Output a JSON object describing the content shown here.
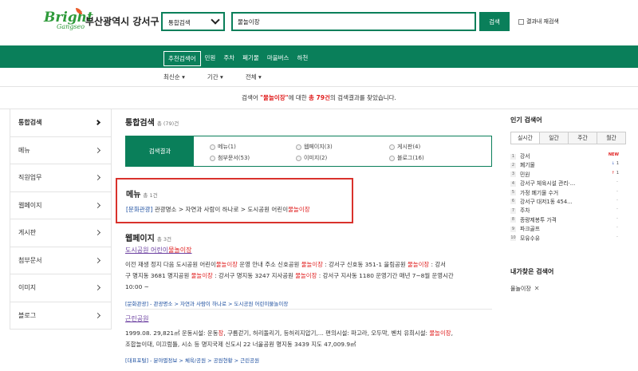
{
  "header": {
    "logo_main": "Bright",
    "logo_sub": "Gangseo",
    "city_name": "부산광역시 강서구",
    "scope_select": "통합검색",
    "search_value": "물놀이장",
    "search_button": "검색",
    "rescan_label": "결과내 재검색"
  },
  "nav": {
    "items": [
      "추천검색어",
      "민원",
      "주차",
      "폐기물",
      "마을버스",
      "하천"
    ]
  },
  "sorts": [
    "최신순 ▾",
    "기간 ▾",
    "전체 ▾"
  ],
  "notice": {
    "pre": "검색어 ",
    "keyword": "\"물놀이장\"",
    "mid": "에 대한 ",
    "count": "총 79건",
    "post": "의 검색결과를 찾았습니다."
  },
  "sidebar": {
    "items": [
      "통합검색",
      "메뉴",
      "직원업무",
      "웹페이지",
      "게시판",
      "첨부문서",
      "이미지",
      "블로그"
    ]
  },
  "main": {
    "title": "통합검색",
    "count": "총 (79)건",
    "filter_label": "검색결과",
    "filters": [
      "메뉴(1)",
      "웹페이지(3)",
      "게시판(4)",
      "첨부문서(53)",
      "이미지(2)",
      "블로그(16)"
    ],
    "menu_section": {
      "title": "메뉴",
      "count": "총 1건",
      "tag": "[문화관광]",
      "path": " 관광명소 > 자연과 사람이 하나로 > 도시공원 어린이",
      "hl": "물놀이장"
    },
    "webpage_section": {
      "title": "웹페이지",
      "count": "총 3건",
      "result1": {
        "link_pre": "도시공원 어린이",
        "link_hl": "물놀이장",
        "line1_a": "이전 재생 정지 다음 도시공원 어린이",
        "line1_hl1": "물놀이장",
        "line1_b": " 운영 안내 주소 신호공원 ",
        "line1_hl2": "물놀이장",
        "line1_c": " : 강서구 신호동 351-1 을림공원 ",
        "line1_hl3": "물놀이장",
        "line1_d": " : 강서",
        "line2_a": "구 명지동 3681 명지공원 ",
        "line2_hl1": "물놀이장",
        "line2_b": " : 강서구 명지동 3247 지사공원 ",
        "line2_hl2": "물놀이장",
        "line2_c": " : 강서구 지사동 1180 운영기간 매년 7~8월 운영시간",
        "line3": "10:00 ~",
        "path": "[문화관광] - 관광명소 > 자연과 사람이 하나로 > 도시공원 어린이물놀이장"
      },
      "result2": {
        "link": "근린공원",
        "line1_a": "1999.08. 29,821㎡ 운동시설: 운동",
        "line1_hl1": "장",
        "line1_b": ", 구름걷기, 허리돌리기, 등허리지압기,... 편의시설: 파고라, 오두막, 벤치 유희시설: ",
        "line1_hl2": "물놀이장",
        "line1_c": ",",
        "line2": "조합놀이대, 미끄럼틀, 시소 등 명지국제 신도시 22 너울공원 명지동 3439 지도 47,009.9㎡",
        "path": "[대표포털] - 분야별정보 > 체육/공원 > 공원현황 > 근린공원"
      }
    }
  },
  "right": {
    "popular_title": "인기 검색어",
    "tabs": [
      "실시간",
      "일간",
      "주간",
      "월간"
    ],
    "popular": [
      {
        "num": "1",
        "text": "강서",
        "badge": "NEW"
      },
      {
        "num": "2",
        "text": "폐기물",
        "trend": "1",
        "dir": "down"
      },
      {
        "num": "3",
        "text": "민원",
        "trend": "1",
        "dir": "up"
      },
      {
        "num": "4",
        "text": "강서구 체육시설 관리·...",
        "dash": "-"
      },
      {
        "num": "5",
        "text": "가정 폐기물 수거",
        "dash": "-"
      },
      {
        "num": "6",
        "text": "강서구 대저1동 454...",
        "dash": "-"
      },
      {
        "num": "7",
        "text": "주차",
        "dash": "-"
      },
      {
        "num": "8",
        "text": "종량제봉투 가격",
        "dash": "-"
      },
      {
        "num": "9",
        "text": "파크골프",
        "dash": "-"
      },
      {
        "num": "10",
        "text": "모유수유",
        "dash": "-"
      }
    ],
    "my_title": "내가찾은 검색어",
    "my_item": "물놀이장",
    "my_remove": "✕"
  },
  "colors": {
    "brand_green": "#0a7f5a",
    "highlight_red": "#e02020",
    "menu_box_border": "#d9322c"
  }
}
